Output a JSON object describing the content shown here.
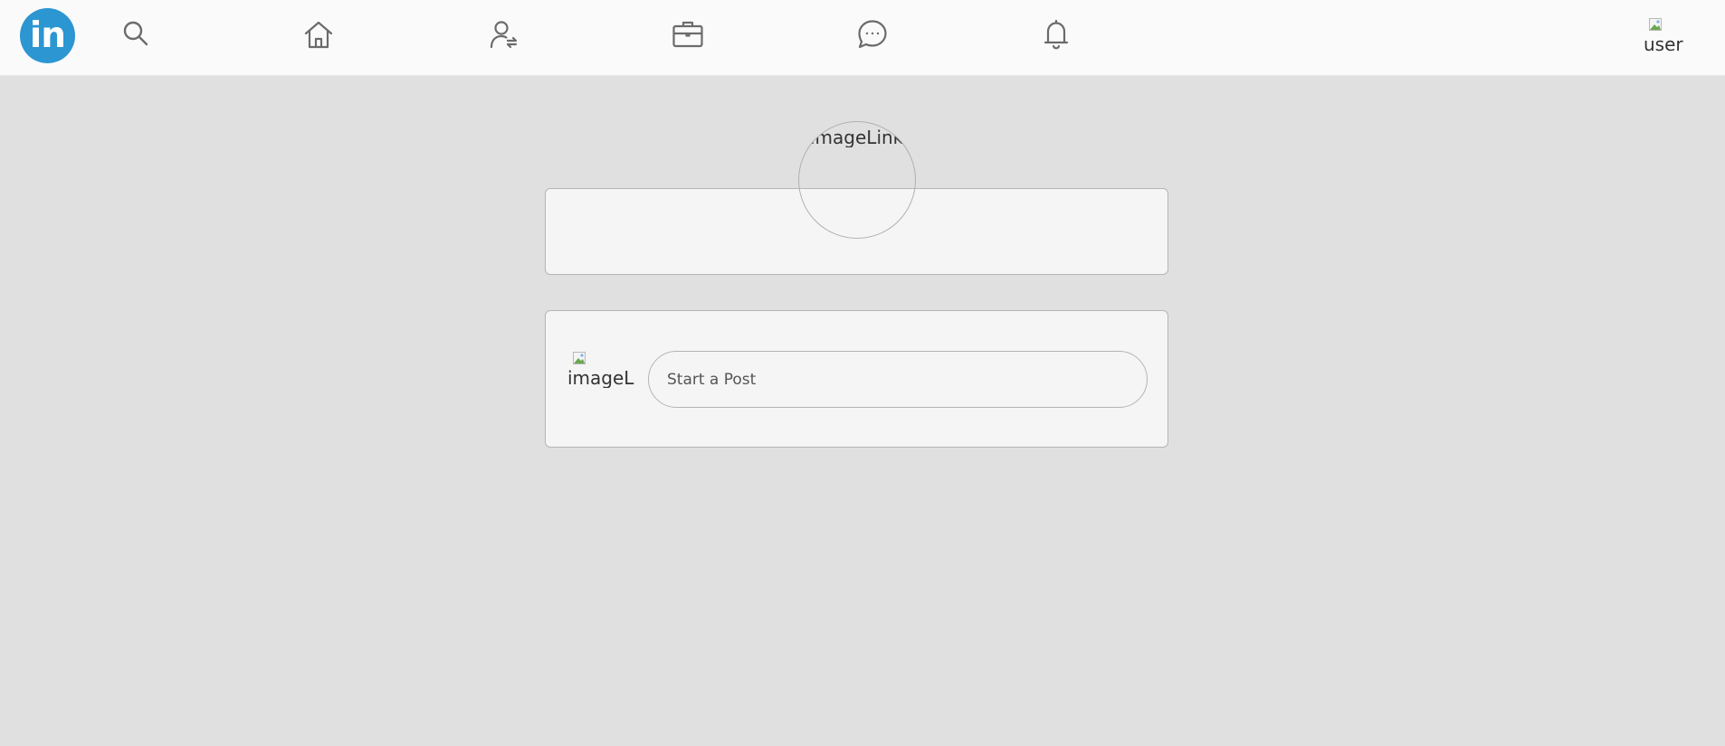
{
  "header": {
    "logo_text": "in",
    "brand_color": "#2b96d1",
    "nav": [
      {
        "name": "search",
        "icon": "search-icon"
      },
      {
        "name": "home",
        "icon": "home-icon"
      },
      {
        "name": "network",
        "icon": "people-icon"
      },
      {
        "name": "jobs",
        "icon": "briefcase-icon"
      },
      {
        "name": "messaging",
        "icon": "chat-icon"
      },
      {
        "name": "notifications",
        "icon": "bell-icon"
      }
    ],
    "user_avatar_alt": "user"
  },
  "profile": {
    "avatar_alt": "imageLink"
  },
  "post": {
    "avatar_alt": "imageLink",
    "placeholder": "Start a Post"
  }
}
